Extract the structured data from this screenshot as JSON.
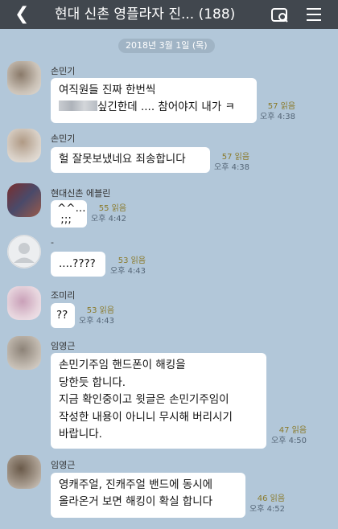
{
  "header": {
    "back_icon": "chevron-left-icon",
    "title": "현대 신촌 영플라자 진...",
    "member_count": "(188)",
    "icons": [
      "chat-search-icon",
      "menu-icon"
    ]
  },
  "date_divider": "2018년 3월 1일 (목)",
  "messages": [
    {
      "sender": "손민기",
      "lines": [
        "여직원들 진짜 한번씩",
        "싶긴한데 .... 참어야지 내가 ㅋ"
      ],
      "read": "57 읽음",
      "time": "오후 4:38"
    },
    {
      "sender": "손민기",
      "lines": [
        "헐 잘못보냈네요 죄송합니다"
      ],
      "read": "57 읽음",
      "time": "오후 4:38"
    },
    {
      "sender": "현대신촌 에블린",
      "lines": [
        "^^...",
        " ;;;"
      ],
      "read": "55 읽음",
      "time": "오후 4:42"
    },
    {
      "sender": "-",
      "lines": [
        "....????"
      ],
      "read": "53 읽음",
      "time": "오후 4:43"
    },
    {
      "sender": "조미리",
      "lines": [
        "??"
      ],
      "read": "53 읽음",
      "time": "오후 4:43"
    },
    {
      "sender": "임영근",
      "lines": [
        "손민기주임 핸드폰이 해킹을",
        "당한듯 합니다.",
        "지금 확인중이고 윗글은 손민기주임이",
        "작성한 내용이 아니니 무시해 버리시기",
        "바랍니다."
      ],
      "read": "47 읽음",
      "time": "오후 4:50"
    },
    {
      "sender": "임영근",
      "lines": [
        "영캐주얼, 진캐주얼  밴드에 동시에",
        "올라온거 보면 해킹이 확실 합니다"
      ],
      "read": "46 읽음",
      "time": "오후 4:52"
    }
  ]
}
